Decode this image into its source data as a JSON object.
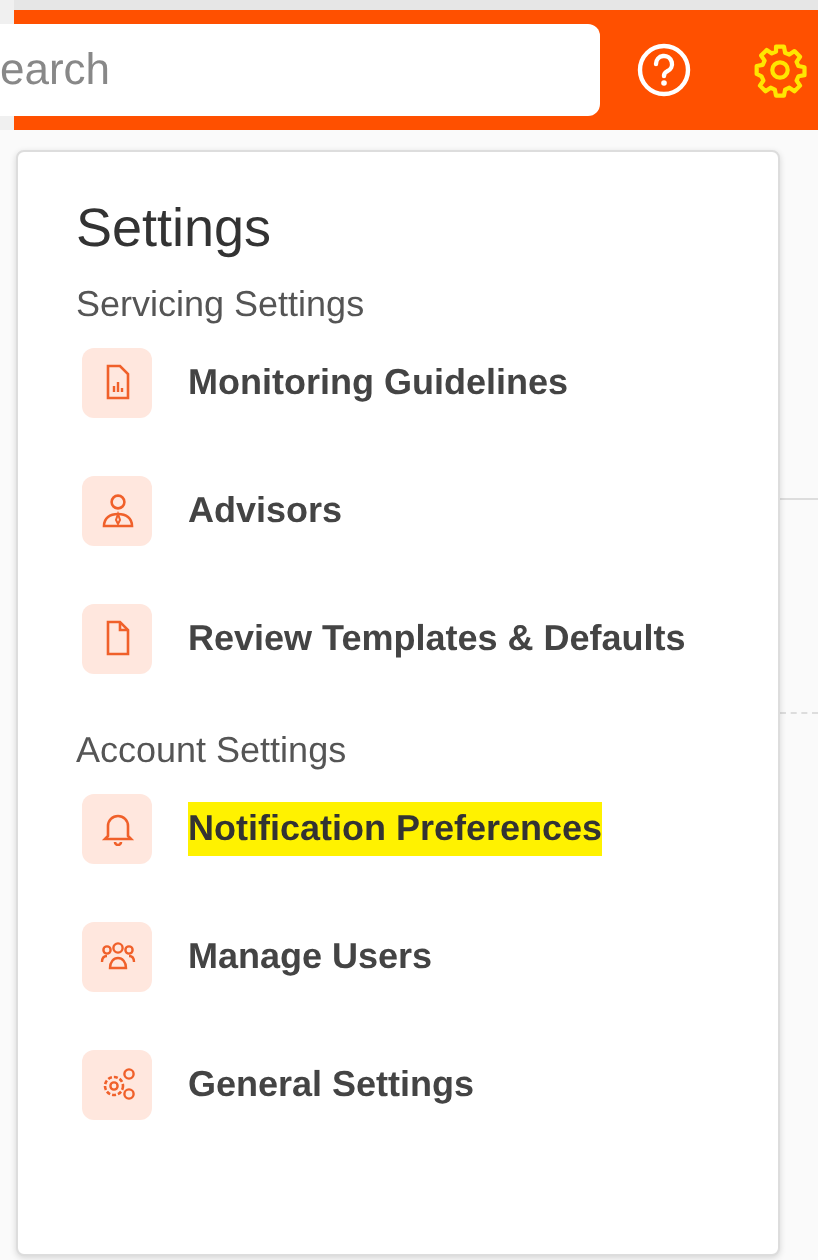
{
  "header": {
    "search": {
      "placeholder": "earch"
    },
    "settings_selected": true
  },
  "menu": {
    "title": "Settings",
    "sections": [
      {
        "label": "Servicing Settings",
        "items": [
          {
            "kind": "report",
            "label": "Monitoring Guidelines",
            "highlighted": false
          },
          {
            "kind": "advisor",
            "label": "Advisors",
            "highlighted": false
          },
          {
            "kind": "document",
            "label": "Review Templates & Defaults",
            "highlighted": false
          }
        ]
      },
      {
        "label": "Account Settings",
        "items": [
          {
            "kind": "bell",
            "label": "Notification Preferences",
            "highlighted": true
          },
          {
            "kind": "users",
            "label": "Manage Users",
            "highlighted": false
          },
          {
            "kind": "gears",
            "label": "General Settings",
            "highlighted": false
          }
        ]
      }
    ]
  }
}
